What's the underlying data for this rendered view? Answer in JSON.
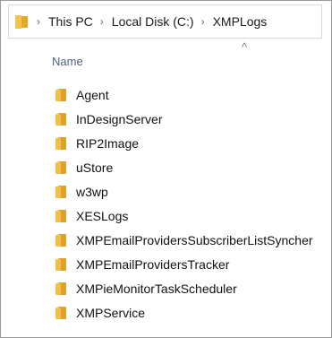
{
  "address_bar": {
    "crumbs": [
      "This PC",
      "Local Disk (C:)",
      "XMPLogs"
    ],
    "separator": "›"
  },
  "column_header": {
    "name": "Name",
    "sort_indicator": "^"
  },
  "files": [
    {
      "name": "Agent",
      "icon": "folder-icon"
    },
    {
      "name": "InDesignServer",
      "icon": "folder-icon"
    },
    {
      "name": "RIP2Image",
      "icon": "folder-icon"
    },
    {
      "name": "uStore",
      "icon": "folder-icon"
    },
    {
      "name": "w3wp",
      "icon": "folder-icon"
    },
    {
      "name": "XESLogs",
      "icon": "folder-icon"
    },
    {
      "name": "XMPEmailProvidersSubscriberListSyncher",
      "icon": "folder-icon"
    },
    {
      "name": "XMPEmailProvidersTracker",
      "icon": "folder-icon"
    },
    {
      "name": "XMPieMonitorTaskScheduler",
      "icon": "folder-icon"
    },
    {
      "name": "XMPService",
      "icon": "folder-icon"
    }
  ],
  "colors": {
    "folder_front": "#f2c04a",
    "folder_back": "#dca22a",
    "header_text": "#4c607a"
  }
}
